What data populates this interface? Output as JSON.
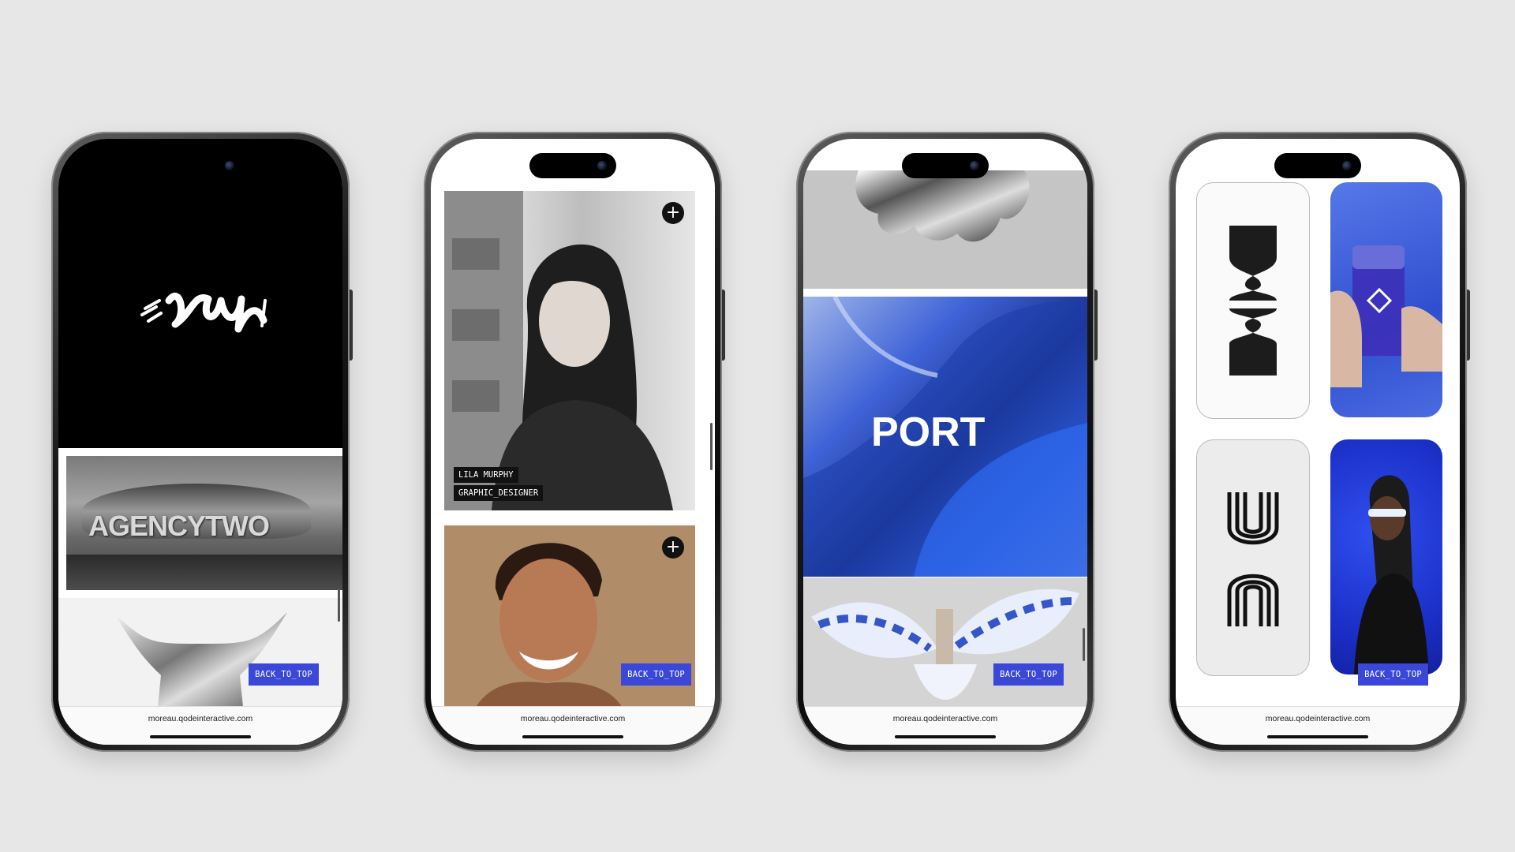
{
  "phones": [
    {
      "url": "moreau.qodeinteractive.com",
      "back_to_top": "BACK_TO_TOP",
      "agency_title": "AGENCYTWO"
    },
    {
      "url": "moreau.qodeinteractive.com",
      "back_to_top": "BACK_TO_TOP",
      "profile_name": "LILA MURPHY",
      "profile_role": "GRAPHIC_DESIGNER",
      "plus_icon": "+"
    },
    {
      "url": "moreau.qodeinteractive.com",
      "back_to_top": "BACK_TO_TOP",
      "port_title": "PORT"
    },
    {
      "url": "moreau.qodeinteractive.com",
      "back_to_top": "BACK_TO_TOP"
    }
  ],
  "colors": {
    "accent": "#3b47d6",
    "background": "#e7e7e7",
    "blue_art": "#2f5fe0"
  },
  "icons": [
    "plus-icon",
    "camera-icon"
  ]
}
